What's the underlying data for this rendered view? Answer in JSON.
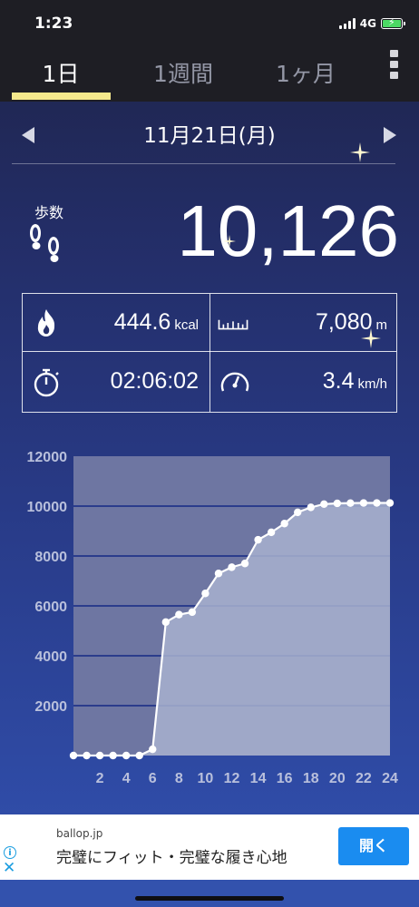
{
  "status_bar": {
    "time": "1:23",
    "network": "4G"
  },
  "tabs": [
    {
      "label": "1日",
      "active": true
    },
    {
      "label": "1週間",
      "active": false
    },
    {
      "label": "1ヶ月",
      "active": false
    }
  ],
  "date": {
    "label": "11月21日(月)"
  },
  "steps": {
    "label": "歩数",
    "value": "10,126"
  },
  "stats": {
    "calories": {
      "value": "444.6",
      "unit": "kcal"
    },
    "distance": {
      "value": "7,080",
      "unit": "m"
    },
    "duration": {
      "value": "02:06:02"
    },
    "speed": {
      "value": "3.4",
      "unit": "km/h"
    }
  },
  "chart_data": {
    "type": "area",
    "title": "",
    "xlabel": "",
    "ylabel": "",
    "x": [
      0,
      1,
      2,
      3,
      4,
      5,
      6,
      7,
      8,
      9,
      10,
      11,
      12,
      13,
      14,
      15,
      16,
      17,
      18,
      19,
      20,
      21,
      22,
      23,
      24
    ],
    "values": [
      0,
      0,
      0,
      0,
      0,
      0,
      250,
      5350,
      5650,
      5750,
      6500,
      7300,
      7550,
      7700,
      8650,
      8950,
      9300,
      9750,
      9950,
      10080,
      10110,
      10120,
      10126,
      10126,
      10126
    ],
    "x_ticks": [
      "2",
      "4",
      "6",
      "8",
      "10",
      "12",
      "14",
      "16",
      "18",
      "20",
      "22",
      "24"
    ],
    "y_ticks": [
      "2000",
      "4000",
      "6000",
      "8000",
      "10000",
      "12000"
    ],
    "xlim": [
      0,
      24
    ],
    "ylim": [
      0,
      12000
    ],
    "grid": true,
    "colors": {
      "line": "#ffffff",
      "fill": "#a8b1cf",
      "plot_bg": "#6e76a2"
    }
  },
  "ad": {
    "domain": "ballop.jp",
    "headline": "完璧にフィット・完璧な履き心地",
    "button": "開く"
  }
}
